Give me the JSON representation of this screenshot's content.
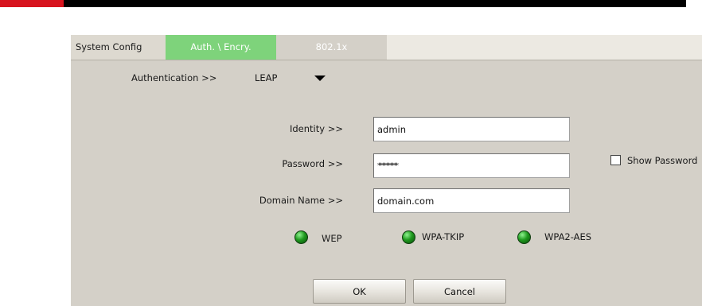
{
  "colors": {
    "tab_active": "#7ed37b",
    "dialog_bg": "#d4d0c8",
    "header_bar": "#000000",
    "header_accent": "#d7141e",
    "status_led": "#1f9a1f"
  },
  "tabs": [
    {
      "label": "System Config"
    },
    {
      "label": "Auth. \\ Encry."
    },
    {
      "label": "802.1x"
    }
  ],
  "authentication": {
    "label": "Authentication >>",
    "value": "LEAP",
    "dropdown_icon": "triangle-down-icon"
  },
  "form": {
    "identity": {
      "label": "Identity >>",
      "value": "admin"
    },
    "password": {
      "label": "Password >>",
      "value": "**********"
    },
    "domain": {
      "label": "Domain Name >>",
      "value": "domain.com"
    },
    "show_password": {
      "label": "Show Password",
      "checked": false
    }
  },
  "encryption_status": [
    {
      "label": "WEP",
      "icon": "green-led-icon"
    },
    {
      "label": "WPA-TKIP",
      "icon": "green-led-icon"
    },
    {
      "label": "WPA2-AES",
      "icon": "green-led-icon"
    }
  ],
  "buttons": {
    "ok": "OK",
    "cancel": "Cancel"
  }
}
